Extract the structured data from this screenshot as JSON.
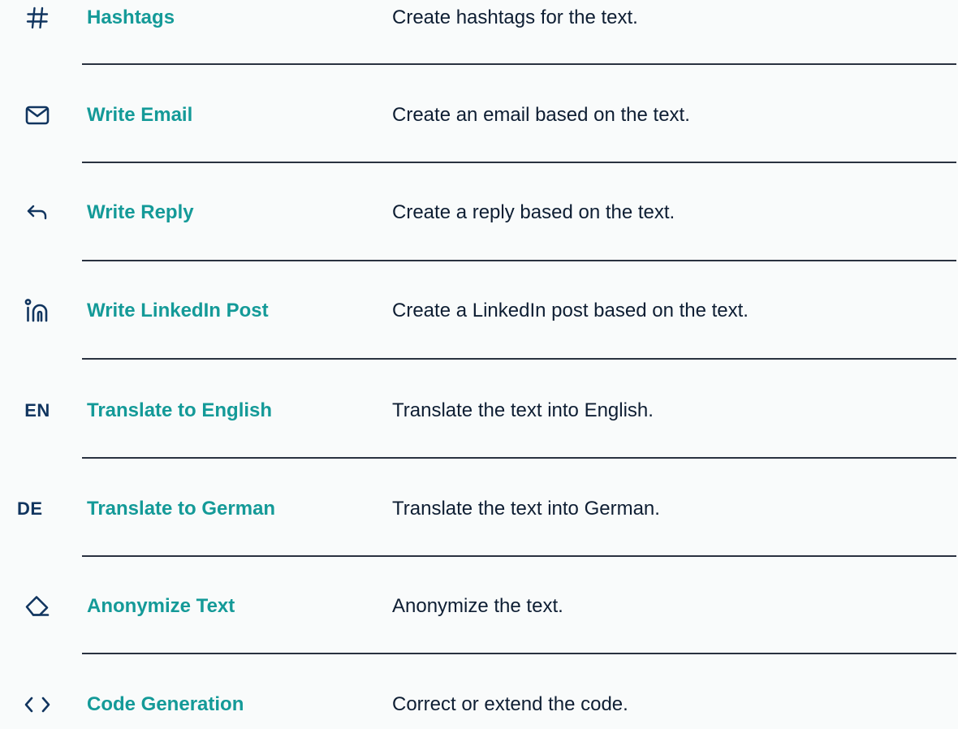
{
  "colors": {
    "title": "#149a98",
    "icon": "#11355f",
    "description": "#0e1e33",
    "divider": "#2a3240",
    "background": "#f9fbfb"
  },
  "items": [
    {
      "icon": "hashtag-icon",
      "title": "Hashtags",
      "description": "Create hashtags for the text."
    },
    {
      "icon": "mail-icon",
      "title": "Write Email",
      "description": "Create an email based on the text."
    },
    {
      "icon": "reply-arrow-icon",
      "title": "Write Reply",
      "description": "Create a reply based on the text."
    },
    {
      "icon": "linkedin-icon",
      "title": "Write LinkedIn Post",
      "description": "Create a LinkedIn post based on the text."
    },
    {
      "icon": "language-en-icon",
      "icon_text": "EN",
      "title": "Translate to English",
      "description": "Translate the text into English."
    },
    {
      "icon": "language-de-icon",
      "icon_text": "DE",
      "title": "Translate to German",
      "description": "Translate the text into German."
    },
    {
      "icon": "eraser-icon",
      "title": "Anonymize Text",
      "description": "Anonymize the text."
    },
    {
      "icon": "code-brackets-icon",
      "title": "Code Generation",
      "description": "Correct or extend the code."
    }
  ]
}
